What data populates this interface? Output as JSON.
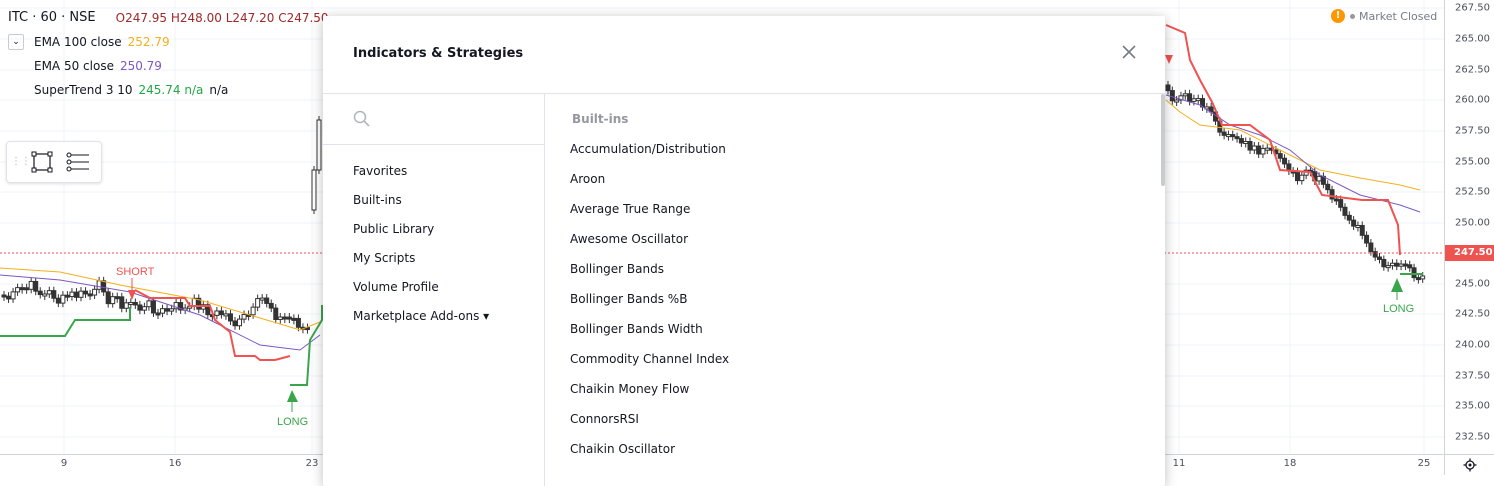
{
  "legend": {
    "symbol": "ITC · 60 · NSE",
    "ohlc": "O247.95 H248.00 L247.20 C247.50",
    "indicators": [
      {
        "label": "EMA 100 close",
        "value": "252.79",
        "color": "#f2b01e"
      },
      {
        "label": "EMA 50 close",
        "value": "250.79",
        "color": "#7e57c2"
      },
      {
        "label": "SuperTrend 3 10",
        "value": "245.74 n/a",
        "extra": "n/a",
        "color": "#22a745"
      }
    ]
  },
  "market_status": {
    "icon": "warning-icon",
    "label": "Market Closed"
  },
  "drawing_toolbar": {
    "icons": [
      "grip-icon",
      "rectangle-icon",
      "settings-lines-icon"
    ]
  },
  "price_axis": {
    "ticks": [
      "267.50",
      "265.00",
      "262.50",
      "260.00",
      "257.50",
      "255.00",
      "252.50",
      "250.00",
      "245.00",
      "242.50",
      "240.00",
      "237.50",
      "235.00",
      "232.50"
    ],
    "current_price": "247.50",
    "current_color": "#ef5350"
  },
  "time_axis": {
    "ticks": [
      "9",
      "16",
      "23",
      "11",
      "18",
      "25"
    ]
  },
  "signals": {
    "short_label": "SHORT",
    "long_label": "LONG",
    "short_color": "#ef5350",
    "long_color": "#3aa64c"
  },
  "modal": {
    "title": "Indicators & Strategies",
    "search_placeholder": "",
    "nav": [
      "Favorites",
      "Built-ins",
      "Public Library",
      "My Scripts",
      "Volume Profile",
      "Marketplace Add-ons ▾"
    ],
    "section_title": "Built-ins",
    "indicators": [
      "Accumulation/Distribution",
      "Aroon",
      "Average True Range",
      "Awesome Oscillator",
      "Bollinger Bands",
      "Bollinger Bands %B",
      "Bollinger Bands Width",
      "Commodity Channel Index",
      "Chaikin Money Flow",
      "ConnorsRSI",
      "Chaikin Oscillator"
    ]
  }
}
